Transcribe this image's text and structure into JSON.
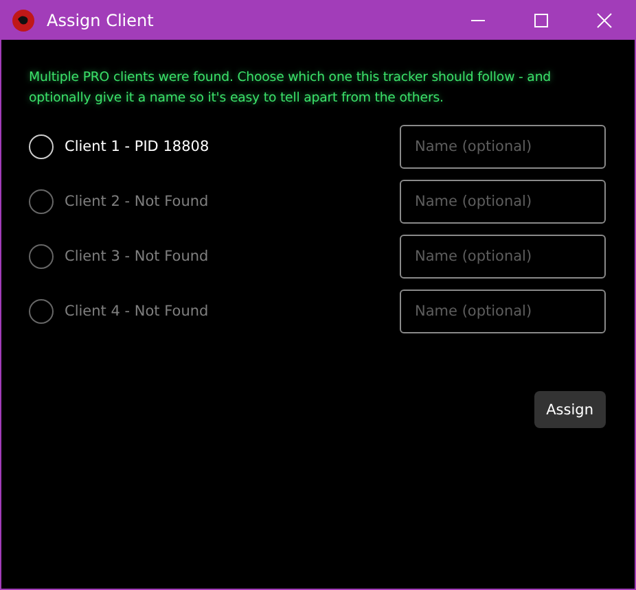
{
  "window": {
    "title": "Assign Client"
  },
  "message": "Multiple PRO clients were found. Choose which one this tracker should follow - and optionally give it a name so it's easy to tell apart from the others.",
  "clients": [
    {
      "label": "Client 1 - PID 18808",
      "selected": false,
      "disabled": false,
      "name_field": {
        "placeholder": "Name (optional)"
      }
    },
    {
      "label": "Client 2 - Not Found",
      "selected": false,
      "disabled": true,
      "name_field": {
        "placeholder": "Name (optional)"
      }
    },
    {
      "label": "Client 3 - Not Found",
      "selected": false,
      "disabled": true,
      "name_field": {
        "placeholder": "Name (optional)"
      }
    },
    {
      "label": "Client 4 - Not Found",
      "selected": false,
      "disabled": true,
      "name_field": {
        "placeholder": "Name (optional)"
      }
    }
  ],
  "buttons": [
    "Assign"
  ]
}
